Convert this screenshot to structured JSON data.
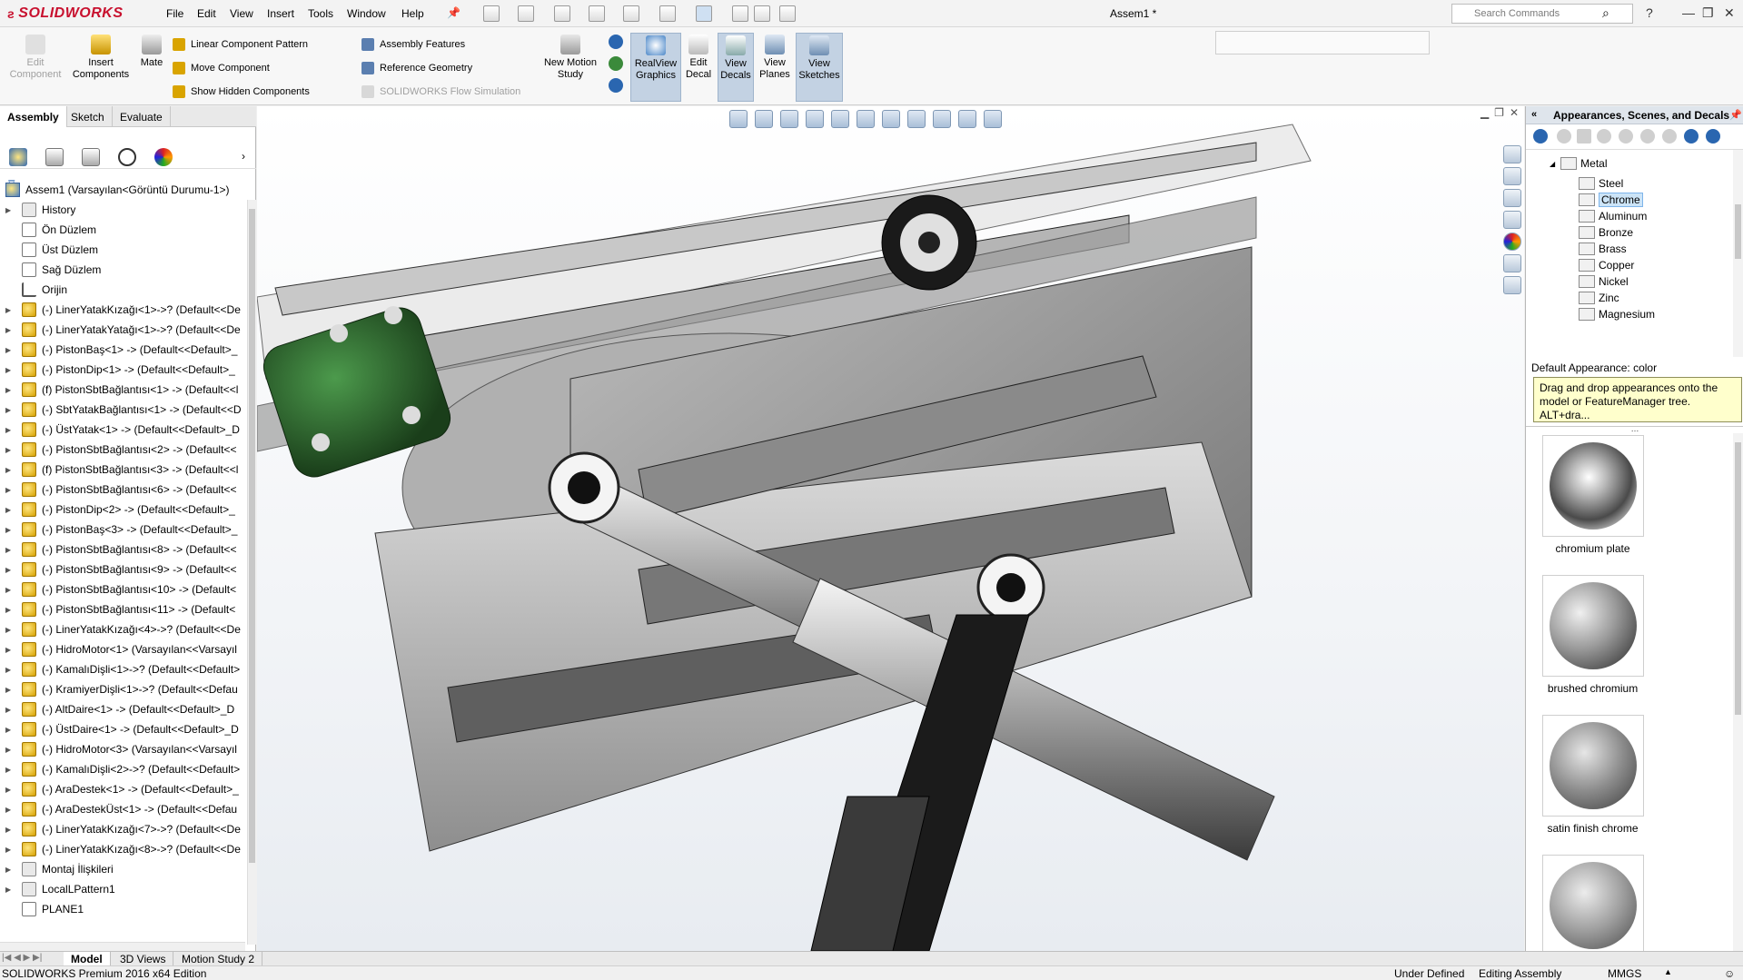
{
  "app": {
    "brand": "SOLIDWORKS",
    "document_title": "Assem1 *",
    "menu": [
      "File",
      "Edit",
      "View",
      "Insert",
      "Tools",
      "Window",
      "Help"
    ],
    "search_placeholder": "Search Commands"
  },
  "ribbon": {
    "edit_component": "Edit Component",
    "insert_components": "Insert Components",
    "mate": "Mate",
    "linear_pattern": "Linear Component Pattern",
    "move_component": "Move Component",
    "show_hidden": "Show Hidden Components",
    "assembly_features": "Assembly Features",
    "reference_geometry": "Reference Geometry",
    "flow_simulation": "SOLIDWORKS Flow Simulation",
    "new_motion_study": "New Motion Study",
    "realview": "RealView Graphics",
    "edit_decal": "Edit Decal",
    "view_decals": "View Decals",
    "view_planes": "View Planes",
    "view_sketches": "View Sketches"
  },
  "command_tabs": [
    "Assembly",
    "Sketch",
    "Evaluate"
  ],
  "feature_tree": {
    "root": "Assem1  (Varsayılan<Görüntü Durumu-1>)",
    "items": [
      {
        "label": "History",
        "type": "folder"
      },
      {
        "label": "Ön Düzlem",
        "type": "plane"
      },
      {
        "label": "Üst Düzlem",
        "type": "plane"
      },
      {
        "label": "Sağ Düzlem",
        "type": "plane"
      },
      {
        "label": "Orijin",
        "type": "origin"
      },
      {
        "label": "(-) LinerYatakKızağı<1>->? (Default<<De",
        "type": "part"
      },
      {
        "label": "(-) LinerYatakYatağı<1>->? (Default<<De",
        "type": "part"
      },
      {
        "label": "(-) PistonBaş<1> -> (Default<<Default>_",
        "type": "part"
      },
      {
        "label": "(-) PistonDip<1> -> (Default<<Default>_",
        "type": "part"
      },
      {
        "label": "(f) PistonSbtBağlantısı<1> -> (Default<<l",
        "type": "part"
      },
      {
        "label": "(-) SbtYatakBağlantısı<1> -> (Default<<D",
        "type": "part"
      },
      {
        "label": "(-) ÜstYatak<1> -> (Default<<Default>_D",
        "type": "part"
      },
      {
        "label": "(-) PistonSbtBağlantısı<2> -> (Default<<",
        "type": "part"
      },
      {
        "label": "(f) PistonSbtBağlantısı<3> -> (Default<<l",
        "type": "part"
      },
      {
        "label": "(-) PistonSbtBağlantısı<6> -> (Default<<",
        "type": "part"
      },
      {
        "label": "(-) PistonDip<2> -> (Default<<Default>_",
        "type": "part"
      },
      {
        "label": "(-) PistonBaş<3> -> (Default<<Default>_",
        "type": "part"
      },
      {
        "label": "(-) PistonSbtBağlantısı<8> -> (Default<<",
        "type": "part"
      },
      {
        "label": "(-) PistonSbtBağlantısı<9> -> (Default<<",
        "type": "part"
      },
      {
        "label": "(-) PistonSbtBağlantısı<10> -> (Default<",
        "type": "part"
      },
      {
        "label": "(-) PistonSbtBağlantısı<11> -> (Default<",
        "type": "part"
      },
      {
        "label": "(-) LinerYatakKızağı<4>->? (Default<<De",
        "type": "part"
      },
      {
        "label": "(-) HidroMotor<1> (Varsayılan<<Varsayıl",
        "type": "part"
      },
      {
        "label": "(-) KamalıDişli<1>->? (Default<<Default>",
        "type": "part"
      },
      {
        "label": "(-) KramiyerDişli<1>->? (Default<<Defau",
        "type": "part"
      },
      {
        "label": "(-) AltDaire<1> -> (Default<<Default>_D",
        "type": "part"
      },
      {
        "label": "(-) ÜstDaire<1> -> (Default<<Default>_D",
        "type": "part"
      },
      {
        "label": "(-) HidroMotor<3> (Varsayılan<<Varsayıl",
        "type": "part"
      },
      {
        "label": "(-) KamalıDişli<2>->? (Default<<Default>",
        "type": "part"
      },
      {
        "label": "(-) AraDestek<1> -> (Default<<Default>_",
        "type": "part"
      },
      {
        "label": "(-) AraDestekÜst<1> -> (Default<<Defau",
        "type": "part"
      },
      {
        "label": "(-) LinerYatakKızağı<7>->? (Default<<De",
        "type": "part"
      },
      {
        "label": "(-) LinerYatakKızağı<8>->? (Default<<De",
        "type": "part"
      },
      {
        "label": "Montaj İlişkileri",
        "type": "folder"
      },
      {
        "label": "LocalLPattern1",
        "type": "folder"
      },
      {
        "label": "PLANE1",
        "type": "plane"
      }
    ]
  },
  "bottom_tabs": [
    "Model",
    "3D Views",
    "Motion Study 2"
  ],
  "status": {
    "edition": "SOLIDWORKS Premium 2016 x64 Edition",
    "definition": "Under Defined",
    "mode": "Editing Assembly",
    "units": "MMGS"
  },
  "task_pane": {
    "title": "Appearances, Scenes, and Decals",
    "tree": {
      "parent": "Metal",
      "children": [
        "Steel",
        "Chrome",
        "Aluminum",
        "Bronze",
        "Brass",
        "Copper",
        "Nickel",
        "Zinc",
        "Magnesium"
      ],
      "selected": "Chrome"
    },
    "default_appearance": "Default Appearance: color",
    "tooltip": "Drag and drop appearances onto the model or FeatureManager tree.  ALT+dra...",
    "swatches": [
      "chromium plate",
      "brushed chromium",
      "satin finish chrome",
      ""
    ]
  },
  "colors": {
    "brand_red": "#c8102e",
    "selection_blue": "#cce4f7",
    "tooltip_yellow": "#ffffcc",
    "motor_green": "#2f6b2f"
  }
}
